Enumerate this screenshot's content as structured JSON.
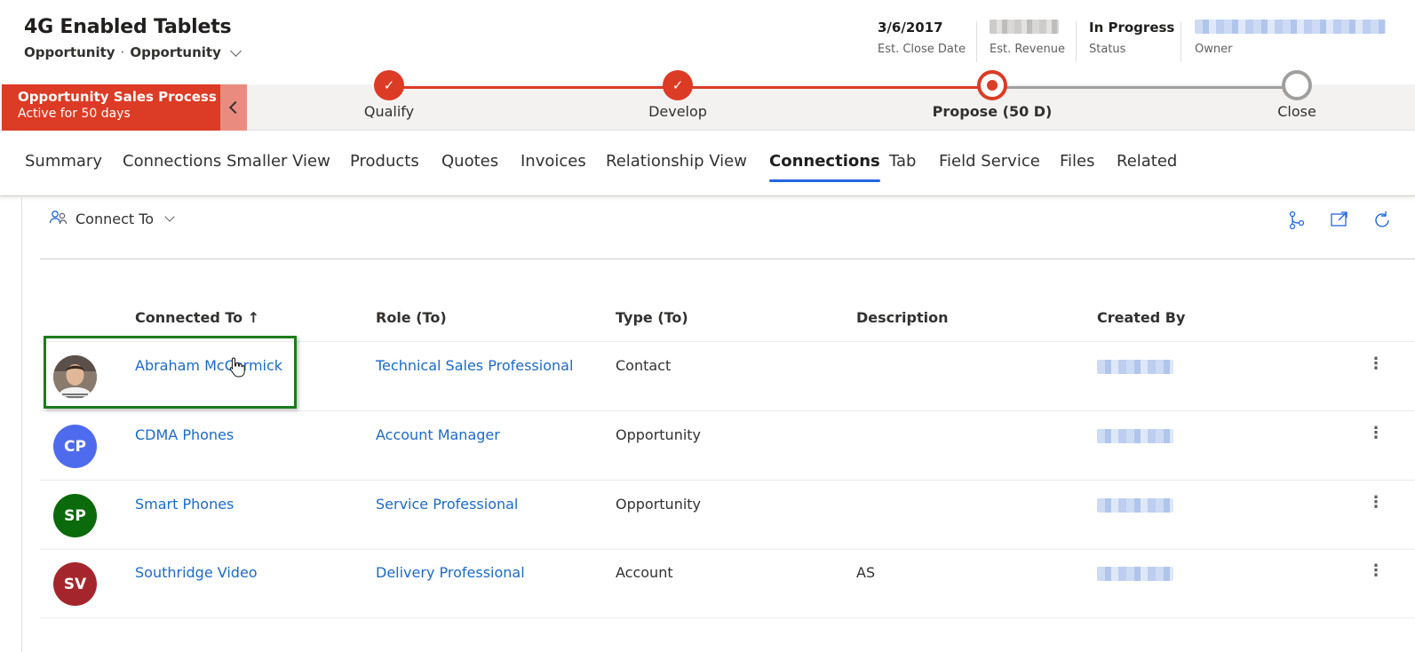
{
  "record": {
    "title": "4G Enabled Tablets",
    "entity": "Opportunity",
    "form": "Opportunity"
  },
  "header_fields": [
    {
      "value": "3/6/2017",
      "label": "Est. Close Date"
    },
    {
      "value": "",
      "label": "Est. Revenue"
    },
    {
      "value": "In Progress",
      "label": "Status"
    },
    {
      "value": "",
      "label": "Owner"
    }
  ],
  "process": {
    "name": "Opportunity Sales Process",
    "duration": "Active for 50 days",
    "stages": [
      {
        "label": "Qualify",
        "state": "done"
      },
      {
        "label": "Develop",
        "state": "done"
      },
      {
        "label": "Propose  (50 D)",
        "state": "active"
      },
      {
        "label": "Close",
        "state": "todo"
      }
    ],
    "colors": {
      "active": "#dc3b25",
      "track_todo": "#a19f9d"
    }
  },
  "tabs": [
    "Summary",
    "Connections Smaller View",
    "Products",
    "Quotes",
    "Invoices",
    "Relationship View",
    "Connections",
    "Tab",
    "Field Service",
    "Files",
    "Related"
  ],
  "selected_tab": "Connections",
  "command_bar": {
    "connect_to": "Connect To"
  },
  "grid": {
    "columns": [
      "Connected To ↑",
      "Role (To)",
      "Type (To)",
      "Description",
      "Created By"
    ],
    "rows": [
      {
        "initials": "",
        "avatar_color": "#7a5a48",
        "name": "Abraham McCormick",
        "role": "Technical Sales Professional",
        "type": "Contact",
        "description": "",
        "created_by": ""
      },
      {
        "initials": "CP",
        "avatar_color": "#4f6bed",
        "name": "CDMA Phones",
        "role": "Account Manager",
        "type": "Opportunity",
        "description": "",
        "created_by": ""
      },
      {
        "initials": "SP",
        "avatar_color": "#0b6a0b",
        "name": "Smart Phones",
        "role": "Service Professional",
        "type": "Opportunity",
        "description": "",
        "created_by": ""
      },
      {
        "initials": "SV",
        "avatar_color": "#a4262c",
        "name": "Southridge Video",
        "role": "Delivery Professional",
        "type": "Account",
        "description": "AS",
        "created_by": ""
      }
    ]
  },
  "icons": {
    "connect": "people-icon",
    "hierarchy": "hierarchy-icon",
    "open": "open-in-window-icon",
    "refresh": "refresh-icon",
    "more": "more-vertical-icon"
  }
}
